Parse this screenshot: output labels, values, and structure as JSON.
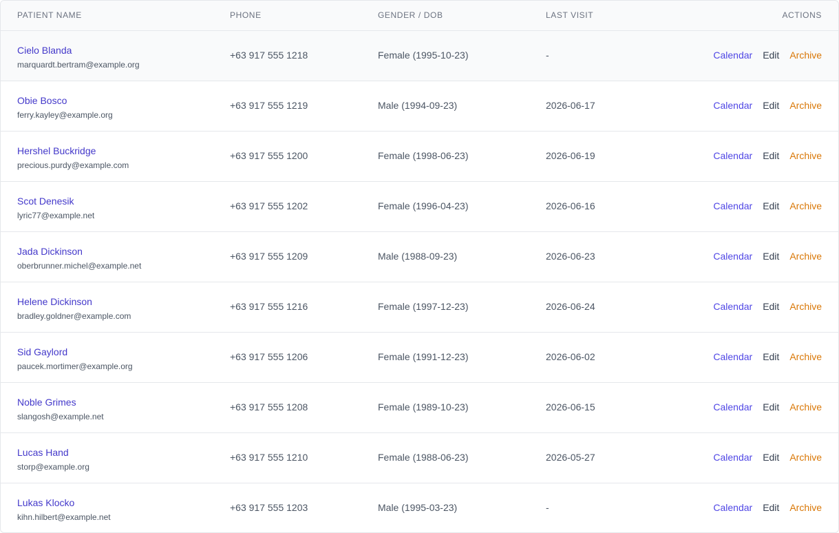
{
  "table": {
    "headers": {
      "patient_name": "PATIENT NAME",
      "phone": "PHONE",
      "gender_dob": "GENDER / DOB",
      "last_visit": "LAST VISIT",
      "actions": "ACTIONS"
    },
    "action_labels": {
      "calendar": "Calendar",
      "edit": "Edit",
      "archive": "Archive"
    },
    "rows": [
      {
        "name": "Cielo Blanda",
        "email": "marquardt.bertram@example.org",
        "phone": "+63 917 555 1218",
        "gender_dob": "Female (1995-10-23)",
        "last_visit": "-"
      },
      {
        "name": "Obie Bosco",
        "email": "ferry.kayley@example.org",
        "phone": "+63 917 555 1219",
        "gender_dob": "Male (1994-09-23)",
        "last_visit": "2026-06-17"
      },
      {
        "name": "Hershel Buckridge",
        "email": "precious.purdy@example.com",
        "phone": "+63 917 555 1200",
        "gender_dob": "Female (1998-06-23)",
        "last_visit": "2026-06-19"
      },
      {
        "name": "Scot Denesik",
        "email": "lyric77@example.net",
        "phone": "+63 917 555 1202",
        "gender_dob": "Female (1996-04-23)",
        "last_visit": "2026-06-16"
      },
      {
        "name": "Jada Dickinson",
        "email": "oberbrunner.michel@example.net",
        "phone": "+63 917 555 1209",
        "gender_dob": "Male (1988-09-23)",
        "last_visit": "2026-06-23"
      },
      {
        "name": "Helene Dickinson",
        "email": "bradley.goldner@example.com",
        "phone": "+63 917 555 1216",
        "gender_dob": "Female (1997-12-23)",
        "last_visit": "2026-06-24"
      },
      {
        "name": "Sid Gaylord",
        "email": "paucek.mortimer@example.org",
        "phone": "+63 917 555 1206",
        "gender_dob": "Female (1991-12-23)",
        "last_visit": "2026-06-02"
      },
      {
        "name": "Noble Grimes",
        "email": "slangosh@example.net",
        "phone": "+63 917 555 1208",
        "gender_dob": "Female (1989-10-23)",
        "last_visit": "2026-06-15"
      },
      {
        "name": "Lucas Hand",
        "email": "storp@example.org",
        "phone": "+63 917 555 1210",
        "gender_dob": "Female (1988-06-23)",
        "last_visit": "2026-05-27"
      },
      {
        "name": "Lukas Klocko",
        "email": "kihn.hilbert@example.net",
        "phone": "+63 917 555 1203",
        "gender_dob": "Male (1995-03-23)",
        "last_visit": "-"
      }
    ]
  },
  "colors": {
    "name_link": "#4338ca",
    "calendar_action": "#4f46e5",
    "edit_action": "#374151",
    "archive_action": "#d97706",
    "header_bg": "#f9fafb",
    "border": "#e5e7eb"
  }
}
